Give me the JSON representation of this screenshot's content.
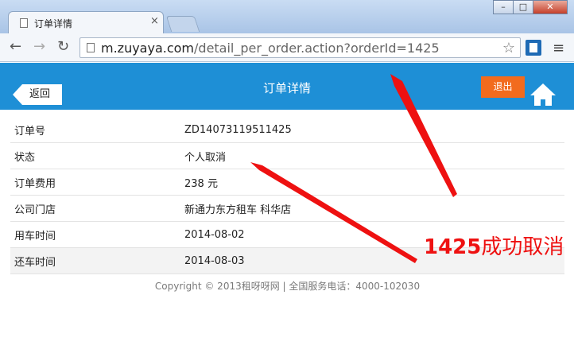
{
  "browser": {
    "tab_title": "订单详情",
    "tab_close": "×",
    "url_host": "m.zuyaya.com",
    "url_path": "/detail_per_order.action?orderId=1425",
    "window_buttons": [
      "–",
      "□",
      "✕"
    ]
  },
  "header": {
    "back_label": "返回",
    "title": "订单详情",
    "logout_label": "退出"
  },
  "details": [
    {
      "label": "订单号",
      "value": "ZD14073119511425"
    },
    {
      "label": "状态",
      "value": "个人取消"
    },
    {
      "label": "订单费用",
      "value": "238 元"
    },
    {
      "label": "公司门店",
      "value": "新通力东方租车 科华店"
    },
    {
      "label": "用车时间",
      "value": "2014-08-02"
    },
    {
      "label": "还车时间",
      "value": "2014-08-03"
    }
  ],
  "footer": {
    "copyright": "Copyright © 2013租呀呀网 | 全国服务电话：4000-102030"
  },
  "annotation": {
    "number": "1425",
    "text": "成功取消",
    "color": "#ee1111"
  },
  "colors": {
    "header_bg": "#1e8fd6",
    "logout_bg": "#f26b1d"
  }
}
